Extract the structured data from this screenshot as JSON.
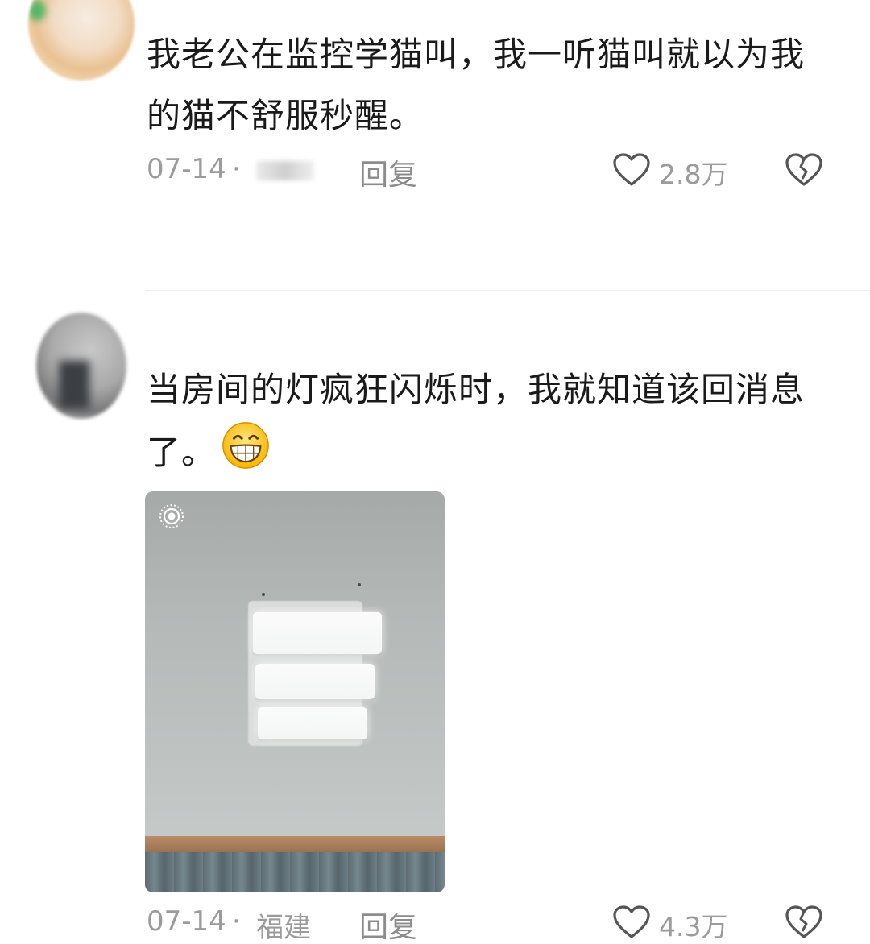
{
  "comments": [
    {
      "text": "我老公在监控学猫叫，我一听猫叫就以为我的猫不舒服秒醒。",
      "date": "07-14",
      "location": "",
      "reply_label": "回复",
      "likes": "2.8万"
    },
    {
      "text": "当房间的灯疯狂闪烁时，我就知道该回消息了。",
      "date": "07-14",
      "location": "福建",
      "reply_label": "回复",
      "likes": "4.3万",
      "emoji": "grin-emoji"
    }
  ],
  "icons": {
    "like": "heart-outline-icon",
    "dislike": "broken-heart-icon",
    "live_photo": "live-photo-icon"
  },
  "colors": {
    "text": "#1a1a1a",
    "meta": "#9b9b9b",
    "divider": "#eeeeee"
  }
}
